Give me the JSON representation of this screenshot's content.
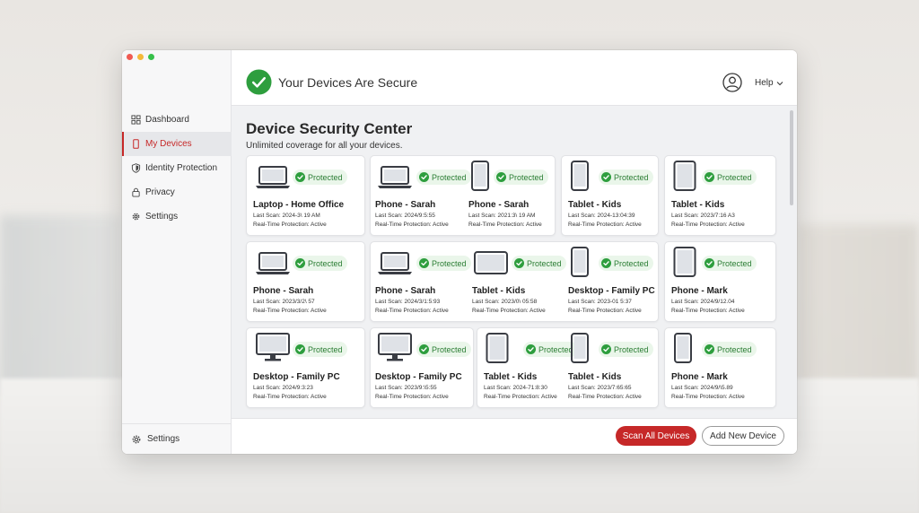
{
  "sidebar": {
    "items": [
      {
        "label": "Dashboard",
        "icon": "grid-icon"
      },
      {
        "label": "My Devices",
        "icon": "phone-icon",
        "active": true
      },
      {
        "label": "Identity Protection",
        "icon": "shield-icon"
      },
      {
        "label": "Privacy",
        "icon": "lock-icon"
      },
      {
        "label": "Settings",
        "icon": "gear-icon"
      }
    ],
    "bottom_label": "Settings"
  },
  "header": {
    "title": "Your Devices Are Secure",
    "help_label": "Help"
  },
  "main": {
    "title": "Device Security Center",
    "subtitle": "Unlimited coverage for all your devices."
  },
  "status_label": "Protected",
  "devices": [
    {
      "name": "Laptop - Home Office",
      "type": "laptop",
      "scan": "Last Scan: 2024-3\\ 19 AM",
      "rtp": "Real-Time Protection: Active"
    },
    {
      "name": "Phone - Sarah",
      "type": "laptop",
      "scan": "Last Scan: 2024/9:5:55",
      "rtp": "Real-Time Protection: Active"
    },
    {
      "name": "Phone - Sarah",
      "type": "phone",
      "scan": "Last Scan: 2021:3\\ 19 AM",
      "rtp": "Real-Time Protection: Active"
    },
    {
      "name": "Tablet - Kids",
      "type": "phone",
      "scan": "Last Scan: 2024-13:04:39",
      "rtp": "Real-Time Protection: Active"
    },
    {
      "name": "Tablet - Kids",
      "type": "tablet",
      "scan": "Last Scan: 2023/7:16 A3",
      "rtp": "Real-Time Protection: Active"
    },
    {
      "name": "Phone - Sarah",
      "type": "laptop",
      "scan": "Last Scan: 2023/3/2\\ 57",
      "rtp": "Real-Time Protection: Active"
    },
    {
      "name": "Phone - Sarah",
      "type": "laptop",
      "scan": "Last Scan: 2024/3/1:5:93",
      "rtp": "Real-Time Protection: Active"
    },
    {
      "name": "Tablet - Kids",
      "type": "tablet-landscape",
      "scan": "Last Scan: 2023/0\\ 05:58",
      "rtp": "Real-Time Protection: Active"
    },
    {
      "name": "Desktop - Family PC",
      "type": "phone",
      "scan": "Last Scan: 2023-01 5:37",
      "rtp": "Real-Time Protection: Active"
    },
    {
      "name": "Phone - Mark",
      "type": "tablet",
      "scan": "Last Scan: 2024/9/12.04",
      "rtp": "Real-Time Protection: Active"
    },
    {
      "name": "Desktop - Family PC",
      "type": "desktop",
      "scan": "Last Scan: 2024/9:3:23",
      "rtp": "Real-Time Protection: Active"
    },
    {
      "name": "Desktop - Family PC",
      "type": "desktop",
      "scan": "Last Scan: 2023/9:\\5:55",
      "rtp": "Real-Time Protection: Active"
    },
    {
      "name": "Tablet - Kids",
      "type": "tablet",
      "scan": "Last Scan: 2024-71:8:30",
      "rtp": "Real-Time Protection: Active"
    },
    {
      "name": "Tablet - Kids",
      "type": "phone",
      "scan": "Last Scan: 2023/7:65:65",
      "rtp": "Real-Time Protection: Active"
    },
    {
      "name": "Phone - Mark",
      "type": "phone",
      "scan": "Last Scan: 2024/9/\\5.89",
      "rtp": "Real-Time Protection: Active"
    }
  ],
  "footer": {
    "scan_label": "Scan All Devices",
    "add_label": "Add New Device"
  },
  "colors": {
    "accent": "#c62828",
    "protected": "#2e9e3e",
    "protected_bg": "#eaf6ea"
  }
}
